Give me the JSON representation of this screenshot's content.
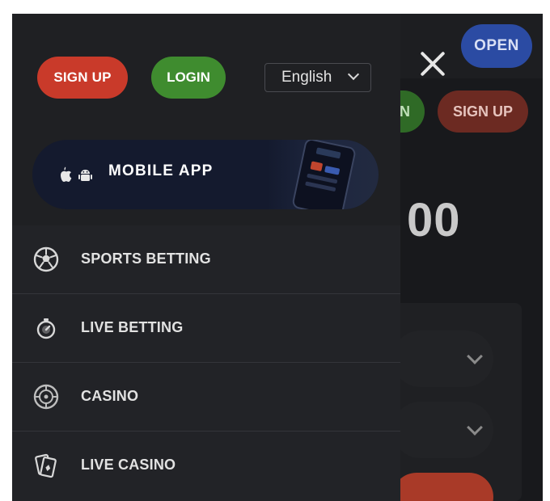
{
  "background_page": {
    "open_label": "OPEN",
    "login_partial": "N",
    "signup_label": "SIGN UP",
    "number_partial": "00"
  },
  "menu": {
    "signup_label": "SIGN UP",
    "login_label": "LOGIN",
    "language": "English",
    "mobile_app_label": "MOBILE APP",
    "items": [
      {
        "label": "SPORTS BETTING",
        "icon": "soccer-ball-icon"
      },
      {
        "label": "LIVE BETTING",
        "icon": "stopwatch-icon"
      },
      {
        "label": "CASINO",
        "icon": "roulette-icon"
      },
      {
        "label": "LIVE CASINO",
        "icon": "playing-cards-icon"
      }
    ]
  },
  "colors": {
    "signup": "#c93a2a",
    "login": "#3f8c2f",
    "open": "#2b4ba3",
    "panel": "#222327"
  }
}
